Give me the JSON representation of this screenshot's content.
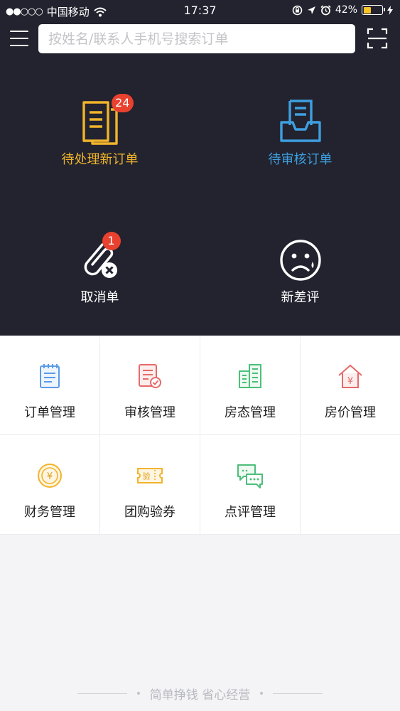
{
  "status_bar": {
    "carrier": "中国移动",
    "time": "17:37",
    "battery": "42%",
    "battery_level": 0.42
  },
  "search": {
    "placeholder": "按姓名/联系人手机号搜索订单"
  },
  "quick_actions": [
    {
      "label": "待处理新订单",
      "badge": "24",
      "icon": "document-list-icon",
      "color": "#f2b42c"
    },
    {
      "label": "待审核订单",
      "icon": "inbox-tray-icon",
      "color": "#3e9fe0"
    },
    {
      "label": "取消单",
      "badge": "1",
      "icon": "paperclip-cancel-icon",
      "color": "#ffffff"
    },
    {
      "label": "新差评",
      "icon": "sad-face-icon",
      "color": "#ffffff"
    }
  ],
  "modules": [
    {
      "label": "订单管理",
      "icon": "notepad-icon"
    },
    {
      "label": "审核管理",
      "icon": "document-check-icon"
    },
    {
      "label": "房态管理",
      "icon": "building-icon"
    },
    {
      "label": "房价管理",
      "icon": "house-yen-icon",
      "glyph": "¥"
    },
    {
      "label": "财务管理",
      "icon": "yen-coin-icon",
      "glyph": "¥"
    },
    {
      "label": "团购验券",
      "icon": "ticket-icon",
      "glyph": "验"
    },
    {
      "label": "点评管理",
      "icon": "chat-bubbles-icon"
    }
  ],
  "footer": {
    "slogan": "简单挣钱 省心经营"
  },
  "colors": {
    "header_bg": "#22232e",
    "accent_yellow": "#f2b42c",
    "accent_blue": "#3e9fe0",
    "badge_red": "#e9412f"
  }
}
